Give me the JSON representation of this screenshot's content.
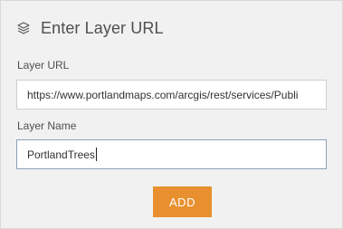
{
  "header": {
    "icon": "layers-icon",
    "title": "Enter Layer URL"
  },
  "form": {
    "url_label": "Layer URL",
    "url_value": "https://www.portlandmaps.com/arcgis/rest/services/Publi",
    "name_label": "Layer Name",
    "name_value": "PortlandTrees",
    "add_label": "ADD"
  },
  "colors": {
    "panel_bg": "#f1f1f1",
    "button_bg": "#e8902f",
    "text": "#4f4f4f"
  }
}
